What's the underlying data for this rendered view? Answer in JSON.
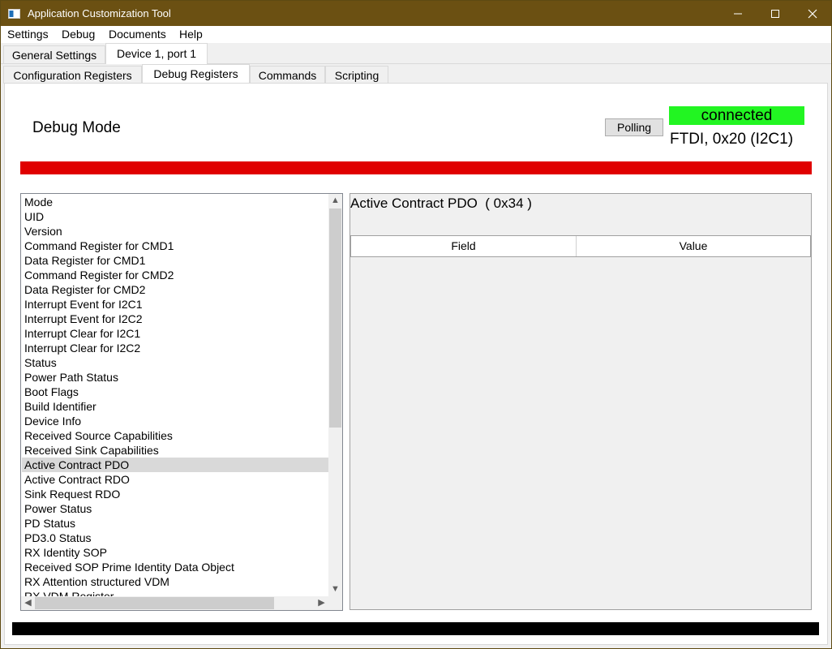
{
  "window": {
    "title": "Application Customization Tool"
  },
  "menu": {
    "items": [
      "Settings",
      "Debug",
      "Documents",
      "Help"
    ]
  },
  "device_tabs": [
    "General Settings",
    "Device 1, port 1"
  ],
  "register_tabs": [
    "Configuration Registers",
    "Debug Registers",
    "Commands",
    "Scripting"
  ],
  "header": {
    "mode_label": "Debug Mode",
    "polling_label": "Polling",
    "status": "connected",
    "connection": "FTDI, 0x20 (I2C1)"
  },
  "colors": {
    "titlebar": "#6b5012",
    "status_ok": "#22f522",
    "alert_bar": "#e00000",
    "footer_bar": "#000000"
  },
  "register_list": {
    "items": [
      "Mode",
      "UID",
      "Version",
      "Command Register for CMD1",
      "Data Register for CMD1",
      "Command Register for CMD2",
      "Data Register for CMD2",
      "Interrupt Event for I2C1",
      "Interrupt Event for I2C2",
      "Interrupt Clear for I2C1",
      "Interrupt Clear for I2C2",
      "Status",
      "Power Path Status",
      "Boot Flags",
      "Build Identifier",
      "Device Info",
      "Received Source Capabilities",
      "Received Sink Capabilities",
      "Active Contract PDO",
      "Active Contract RDO",
      "Sink Request RDO",
      "Power Status",
      "PD Status",
      "PD3.0 Status",
      "RX Identity SOP",
      "Received SOP Prime Identity Data Object",
      "RX Attention structured VDM",
      "RX VDM Register"
    ],
    "selected": "Active Contract PDO"
  },
  "detail": {
    "title": "Active Contract PDO  ( 0x34 )",
    "columns": [
      "Field",
      "Value"
    ]
  }
}
